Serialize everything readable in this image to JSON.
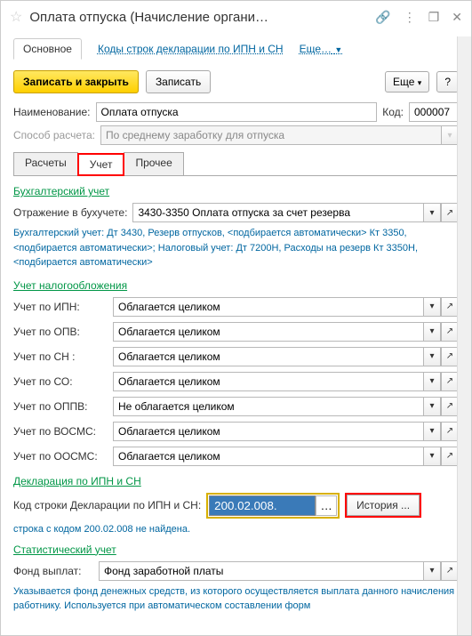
{
  "titlebar": {
    "title": "Оплата отпуска (Начисление органи…"
  },
  "nav": {
    "main": "Основное",
    "codes": "Коды строк декларации по ИПН и СН",
    "more": "Еще…"
  },
  "toolbar": {
    "save_close": "Записать и закрыть",
    "save": "Записать",
    "more": "Еще",
    "help": "?"
  },
  "fields": {
    "name_label": "Наименование:",
    "name_value": "Оплата отпуска",
    "code_label": "Код:",
    "code_value": "000007",
    "method_label": "Способ расчета:",
    "method_value": "По среднему заработку для отпуска"
  },
  "tabs": {
    "calc": "Расчеты",
    "account": "Учет",
    "other": "Прочее"
  },
  "accounting": {
    "title": "Бухгалтерский учет",
    "reflect_label": "Отражение в бухучете:",
    "reflect_value": "3430-3350 Оплата отпуска за счет резерва",
    "info": "Бухгалтерский учет: Дт 3430, Резерв отпусков, <подбирается автоматически> Кт 3350, <подбирается автоматически>; Налоговый учет: Дт 7200Н, Расходы на резерв Кт 3350Н, <подбирается автоматически>"
  },
  "tax": {
    "title": "Учет налогообложения",
    "ipn_label": "Учет по ИПН:",
    "opv_label": "Учет по ОПВ:",
    "sn_label": "Учет по СН :",
    "so_label": "Учет по СО:",
    "oppv_label": "Учет по ОППВ:",
    "vosms_label": "Учет по ВОСМС:",
    "oosms_label": "Учет по ООСМС:",
    "full": "Облагается целиком",
    "not_full": "Не облагается целиком"
  },
  "declaration": {
    "title": "Декларация по ИПН и СН",
    "code_label": "Код строки Декларации по ИПН и СН:",
    "code_value": "200.02.008.",
    "history": "История ...",
    "warning": "строка с кодом 200.02.008 не найдена."
  },
  "stat": {
    "title": "Статистический учет",
    "fund_label": "Фонд выплат:",
    "fund_value": "Фонд заработной платы",
    "info": "Указывается фонд денежных средств, из которого осуществляется выплата данного начисления работнику. Используется при автоматическом составлении форм"
  }
}
